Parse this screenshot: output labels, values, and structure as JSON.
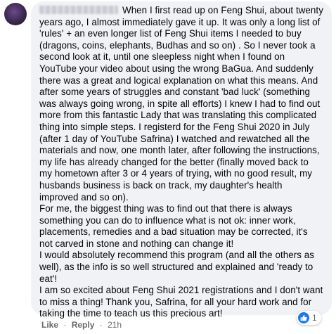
{
  "comment": {
    "author": "",
    "text": "When I first read up on Feng Shui, about twenty years ago, I almost immediately gave it up. It was only a long list of 'rules' + an even longer list of Feng Shui items I needed to buy (dragons, coins, elephants, Budhas and so on) . So I never took a second look at it, until one sleepless night when I found on YouTube your video about using the wrong BaGua. And suddenly there was a great and logical explanation on what this means. And after some years of struggles and constant 'bad luck' (something was always going wrong, in spite all efforts) I knew I had to find out more from this fantastic Lady that was translating this complicated thing into simple steps. I registerd for the Feng Shui 2020 in July (after 1 day of YouTube Safrina) I watched and rewatched all the materials and now, one month later, after following the instructions, my life has already changed for the better (finally moved back to my hometown after 3 or 4 years of trying, with no good result, my husbands business is back on track, my daughter's health improved and so on).\nFor me, the biggest thing was to find out that there is always something you can do to influence what is not ok: inner work, placements, remedies and a bad situation may be corrected, it's not carved in stone and nothing can change it!\nI would absolutely recommend this program (and all the others as well), as the info is so well structured and explained and 'ready to eat'!\nI am so excited about Feng Shui 2021 registrations and I don't want to miss a thing! Thank you, Safrina, for all your hard work and for taking the time to teach us this precious art!"
  },
  "actions": {
    "like": "Like",
    "separator": "·",
    "reply": "Reply",
    "time": "21h"
  },
  "reactions": {
    "icon": "like-thumb-icon",
    "count": "1",
    "color": "#1877f2"
  }
}
